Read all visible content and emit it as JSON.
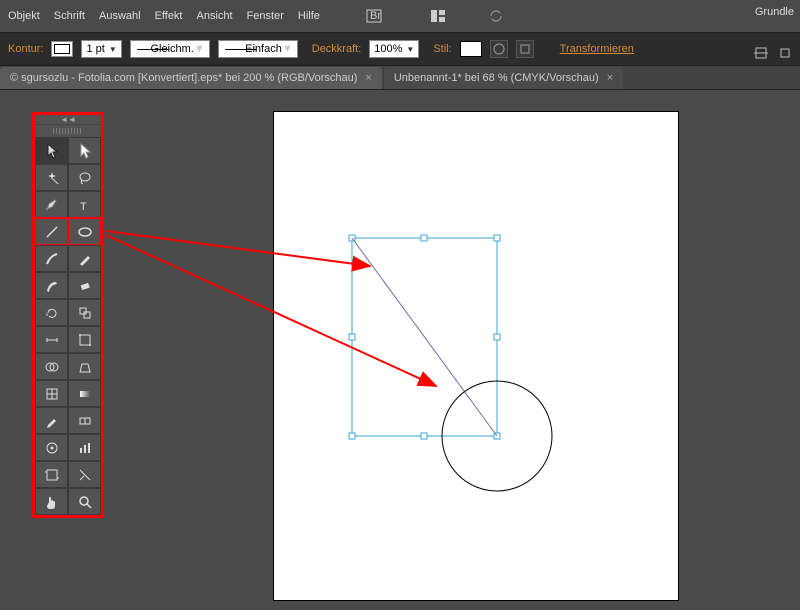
{
  "menu": {
    "items": [
      "Objekt",
      "Schrift",
      "Auswahl",
      "Effekt",
      "Ansicht",
      "Fenster",
      "Hilfe"
    ],
    "right": "Grundle"
  },
  "opt": {
    "kontur": "Kontur:",
    "stroke": "1 pt",
    "dash1": "Gleichm.",
    "dash2": "Einfach",
    "deck": "Deckkraft:",
    "opacity": "100%",
    "stil": "Stil:",
    "trans": "Transformieren"
  },
  "tabs": {
    "t1": "© sgursozlu - Fotolia.com [Konvertiert].eps* bei 200 % (RGB/Vorschau)",
    "t2": "Unbenannt-1* bei 68 % (CMYK/Vorschau)"
  },
  "tools": [
    [
      "selection",
      "direct-selection"
    ],
    [
      "magic-wand",
      "lasso"
    ],
    [
      "pen",
      "type"
    ],
    [
      "line",
      "ellipse"
    ],
    [
      "brush",
      "pencil"
    ],
    [
      "blob",
      "eraser"
    ],
    [
      "rotate",
      "scale"
    ],
    [
      "width",
      "free-transform"
    ],
    [
      "shape-builder",
      "perspective"
    ],
    [
      "mesh",
      "gradient"
    ],
    [
      "eyedropper",
      "blend"
    ],
    [
      "symbol",
      "graph"
    ],
    [
      "artboard",
      "slice"
    ],
    [
      "hand",
      "zoom"
    ]
  ],
  "highlightRow": 3
}
